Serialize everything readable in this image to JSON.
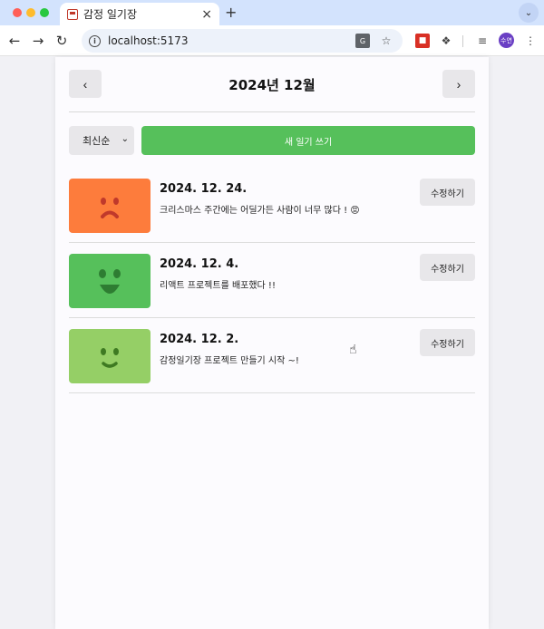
{
  "browser": {
    "tab_title": "감정 일기장",
    "tab_close": "×",
    "new_tab": "+",
    "url": "localhost:5173",
    "avatar_label": "수연"
  },
  "header": {
    "prev_label": "‹",
    "title": "2024년 12월",
    "next_label": "›"
  },
  "menu": {
    "sort_selected": "최신순",
    "new_diary_label": "새 일기 쓰기"
  },
  "diaries": [
    {
      "date": "2024. 12. 24.",
      "content": "크리스마스 주간에는 어딜가든 사람이 너무 많다 ! 😡",
      "emotion_color": "#fd7c3c",
      "emotion_icon": "frown-face-icon",
      "edit_label": "수정하기"
    },
    {
      "date": "2024. 12. 4.",
      "content": "리액트 프로젝트를 배포했다 !!",
      "emotion_color": "#56c05b",
      "emotion_icon": "big-smile-face-icon",
      "edit_label": "수정하기"
    },
    {
      "date": "2024. 12. 2.",
      "content": "감정일기장 프로젝트 만들기 시작 ~!",
      "emotion_color": "#95cf66",
      "emotion_icon": "smile-face-icon",
      "edit_label": "수정하기"
    }
  ]
}
